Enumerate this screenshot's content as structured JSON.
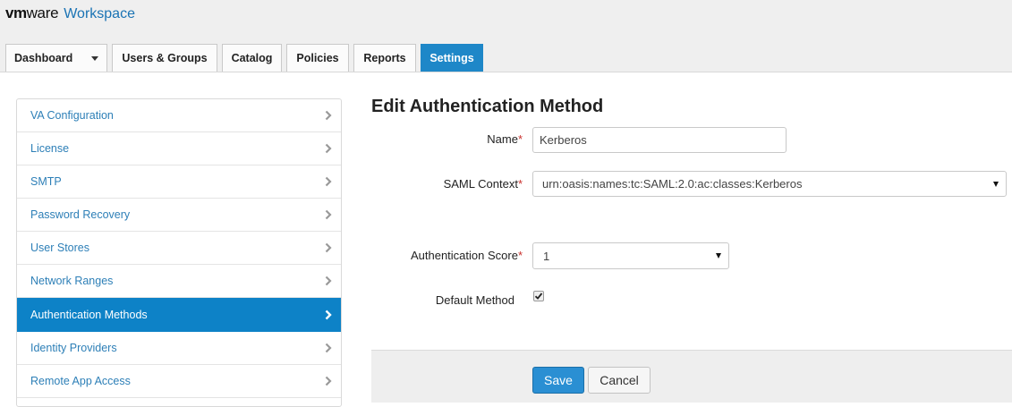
{
  "app": {
    "brand_vm": "vm",
    "brand_ware": "ware",
    "product": "Workspace"
  },
  "tabs": [
    {
      "label": "Dashboard"
    },
    {
      "label": "Users & Groups"
    },
    {
      "label": "Catalog"
    },
    {
      "label": "Policies"
    },
    {
      "label": "Reports"
    },
    {
      "label": "Settings"
    }
  ],
  "active_tab": "Settings",
  "sidebar": {
    "items": [
      {
        "label": "VA Configuration"
      },
      {
        "label": "License"
      },
      {
        "label": "SMTP"
      },
      {
        "label": "Password Recovery"
      },
      {
        "label": "User Stores"
      },
      {
        "label": "Network Ranges"
      },
      {
        "label": "Authentication Methods"
      },
      {
        "label": "Identity Providers"
      },
      {
        "label": "Remote App Access"
      }
    ],
    "active_item": "Authentication Methods"
  },
  "form": {
    "title": "Edit Authentication Method",
    "name_label": "Name",
    "name_value": "Kerberos",
    "saml_label": "SAML Context",
    "saml_value": "urn:oasis:names:tc:SAML:2.0:ac:classes:Kerberos",
    "score_label": "Authentication Score",
    "score_value": "1",
    "default_label": "Default Method",
    "default_checked": true,
    "required_marker": "*"
  },
  "buttons": {
    "save": "Save",
    "cancel": "Cancel"
  },
  "colors": {
    "accent": "#1e87c8",
    "sidebar_active": "#0d82c7",
    "link": "#2d7fb7",
    "required": "#c9302c"
  }
}
